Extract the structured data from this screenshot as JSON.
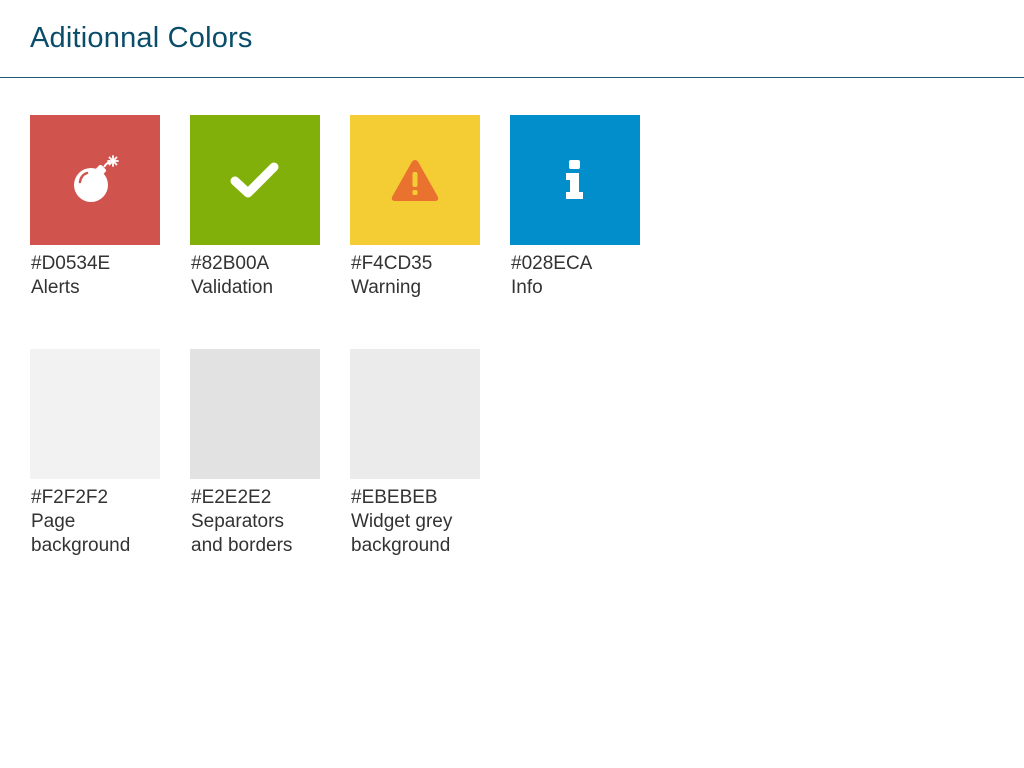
{
  "page": {
    "title": "Aditionnal Colors",
    "title_color": "#0A4D6B",
    "rule_color": "#1F5A70"
  },
  "swatches": [
    {
      "hex": "#D0534E",
      "label": "Alerts",
      "color": "#D0534E",
      "icon": "bomb-icon"
    },
    {
      "hex": "#82B00A",
      "label": "Validation",
      "color": "#82B00A",
      "icon": "checkmark-icon"
    },
    {
      "hex": "#F4CD35",
      "label": "Warning",
      "color": "#F4CD35",
      "icon": "warning-triangle-icon"
    },
    {
      "hex": "#028ECA",
      "label": "Info",
      "color": "#028ECA",
      "icon": "info-icon"
    },
    {
      "hex": "#F2F2F2",
      "label": "Page background",
      "color": "#F2F2F2",
      "icon": ""
    },
    {
      "hex": "#E2E2E2",
      "label": "Separators and borders",
      "color": "#E2E2E2",
      "icon": ""
    },
    {
      "hex": "#EBEBEB",
      "label": "Widget grey background",
      "color": "#EBEBEB",
      "icon": ""
    }
  ]
}
